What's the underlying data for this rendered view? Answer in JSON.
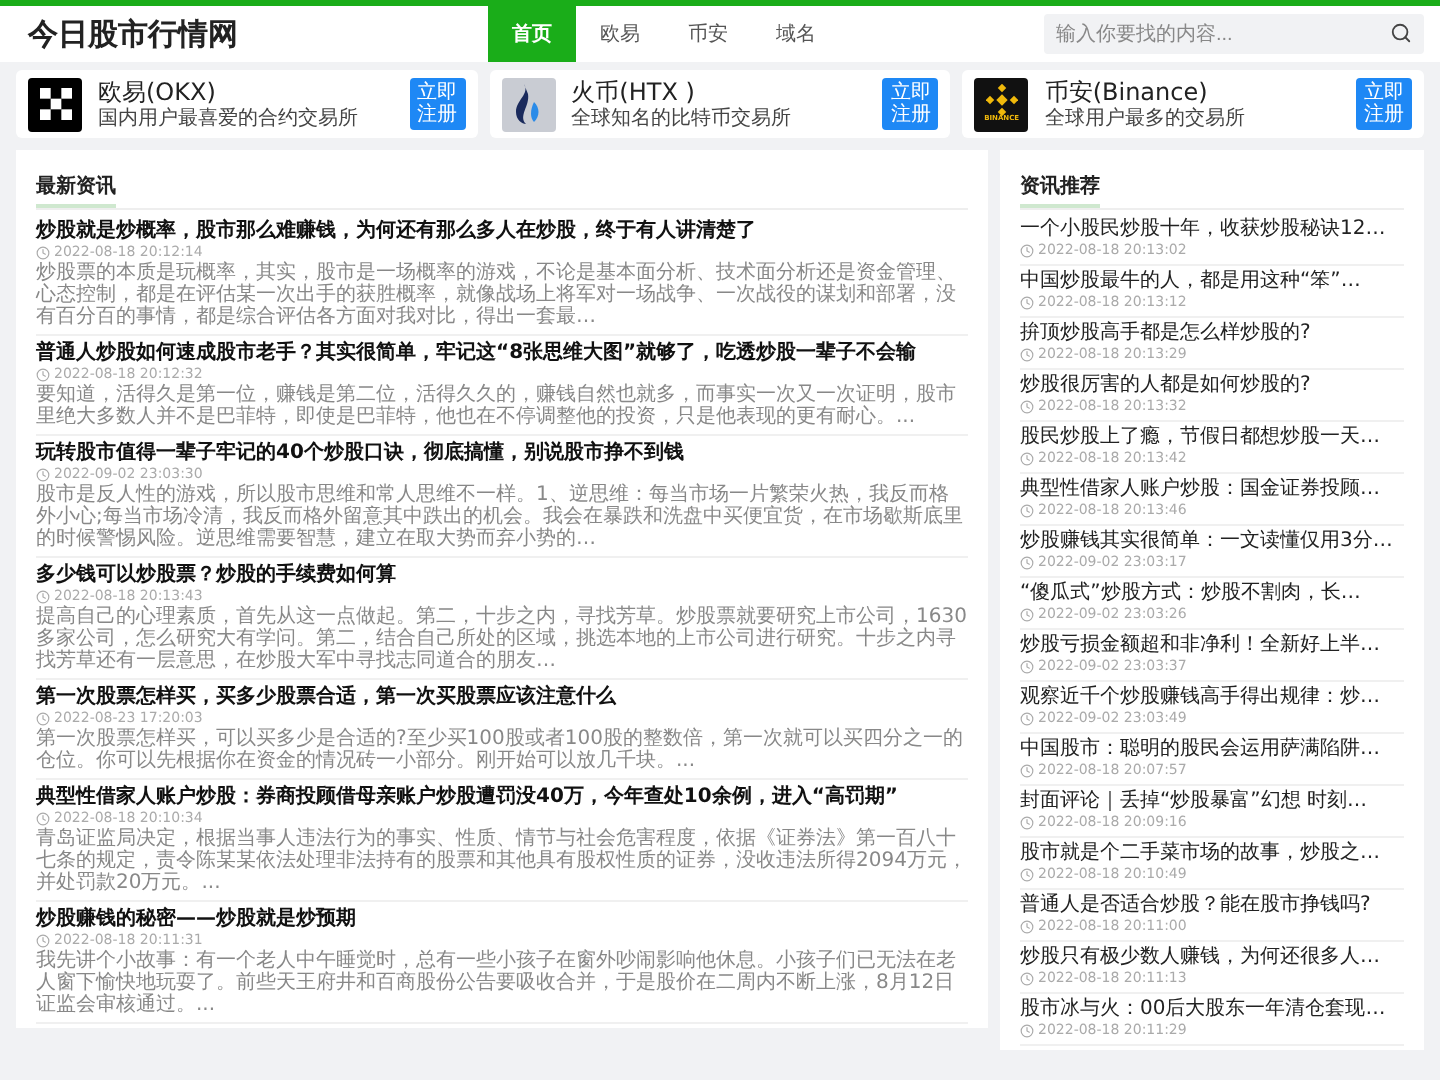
{
  "header": {
    "logo": "今日股市行情网",
    "nav": [
      {
        "label": "首页",
        "selected": true
      },
      {
        "label": "欧易",
        "selected": false
      },
      {
        "label": "币安",
        "selected": false
      },
      {
        "label": "域名",
        "selected": false
      }
    ],
    "search": {
      "placeholder": "输入你要找的内容..."
    }
  },
  "exchanges": [
    {
      "kind": "okx",
      "name": "欧易(OKX)",
      "description": "国内用户最喜爱的合约交易所",
      "button": "立即注册"
    },
    {
      "kind": "htx",
      "name": "火币(HTX )",
      "description": "全球知名的比特币交易所",
      "button": "立即注册"
    },
    {
      "kind": "binance",
      "logo_text": "BINANCE",
      "name": "币安(Binance)",
      "description": "全球用户最多的交易所",
      "button": "立即注册"
    }
  ],
  "news": {
    "title": "最新资讯",
    "items": [
      {
        "title": "炒股就是炒概率，股市那么难赚钱，为何还有那么多人在炒股，终于有人讲清楚了",
        "date": "2022-08-18 20:12:14",
        "summary": "炒股票的本质是玩概率，其实，股市是一场概率的游戏，不论是基本面分析、技术面分析还是资金管理、心态控制，都是在评估某一次出手的获胜概率，就像战场上将军对一场战争、一次战役的谋划和部署，没有百分百的事情，都是综合评估各方面对我对比，得出一套最…"
      },
      {
        "title": "普通人炒股如何速成股市老手？其实很简单，牢记这“8张思维大图”就够了，吃透炒股一辈子不会输",
        "date": "2022-08-18 20:12:32",
        "summary": "要知道，活得久是第一位，赚钱是第二位，活得久久的，赚钱自然也就多，而事实一次又一次证明，股市里绝大多数人并不是巴菲特，即使是巴菲特，他也在不停调整他的投资，只是他表现的更有耐心。..."
      },
      {
        "title": "玩转股市值得一辈子牢记的40个炒股口诀，彻底搞懂，别说股市挣不到钱",
        "date": "2022-09-02 23:03:30",
        "summary": "股市是反人性的游戏，所以股市思维和常人思维不一样。1、逆思维：每当市场一片繁荣火热，我反而格外小心;每当市场冷清，我反而格外留意其中跌出的机会。我会在暴跌和洗盘中买便宜货，在市场歇斯底里的时候警惕风险。逆思维需要智慧，建立在取大势而弃小势的…"
      },
      {
        "title": "多少钱可以炒股票？炒股的手续费如何算",
        "date": "2022-08-18 20:13:43",
        "summary": "提高自己的心理素质，首先从这一点做起。第二，十步之内，寻找芳草。炒股票就要研究上市公司，1630多家公司，怎么研究大有学问。第二，结合自己所处的区域，挑选本地的上市公司进行研究。十步之内寻找芳草还有一层意思，在炒股大军中寻找志同道合的朋友…"
      },
      {
        "title": "第一次股票怎样买，买多少股票合适，第一次买股票应该注意什么",
        "date": "2022-08-23 17:20:03",
        "summary": "第一次股票怎样买，可以买多少是合适的?至少买100股或者100股的整数倍，第一次就可以买四分之一的仓位。你可以先根据你在资金的情况砖一小部分。刚开始可以放几千块。..."
      },
      {
        "title": "典型性借家人账户炒股：券商投顾借母亲账户炒股遭罚没40万，今年查处10余例，进入“高罚期”",
        "date": "2022-08-18 20:10:34",
        "summary": "青岛证监局决定，根据当事人违法行为的事实、性质、情节与社会危害程度，依据《证券法》第一百八十七条的规定，责令陈某某依法处理非法持有的股票和其他具有股权性质的证券，没收违法所得2094万元，并处罚款20万元。..."
      },
      {
        "title": "炒股赚钱的秘密——炒股就是炒预期",
        "date": "2022-08-18 20:11:31",
        "summary": "我先讲个小故事：有一个老人中午睡觉时，总有一些小孩子在窗外吵闹影响他休息。小孩子们已无法在老人窗下愉快地玩耍了。前些天王府井和百商股份公告要吸收合并，于是股价在二周内不断上涨，8月12日证监会审核通过。..."
      }
    ]
  },
  "recommended": {
    "title": "资讯推荐",
    "items": [
      {
        "title": "一个小股民炒股十年，收获炒股秘诀12…",
        "date": "2022-08-18 20:13:02"
      },
      {
        "title": "中国炒股最牛的人，都是用这种“笨”…",
        "date": "2022-08-18 20:13:12"
      },
      {
        "title": "拚顶炒股高手都是怎么样炒股的?",
        "date": "2022-08-18 20:13:29"
      },
      {
        "title": "炒股很厉害的人都是如何炒股的?",
        "date": "2022-08-18 20:13:32"
      },
      {
        "title": "股民炒股上了瘾，节假日都想炒股一天…",
        "date": "2022-08-18 20:13:42"
      },
      {
        "title": "典型性借家人账户炒股：国金证券投顾…",
        "date": "2022-08-18 20:13:46"
      },
      {
        "title": "炒股赚钱其实很简单：一文读懂仅用3分…",
        "date": "2022-09-02 23:03:17"
      },
      {
        "title": "“傻瓜式”炒股方式：炒股不割肉，长…",
        "date": "2022-09-02 23:03:26"
      },
      {
        "title": "炒股亏损金额超和非净利！全新好上半…",
        "date": "2022-09-02 23:03:37"
      },
      {
        "title": "观察近千个炒股赚钱高手得出规律：炒…",
        "date": "2022-09-02 23:03:49"
      },
      {
        "title": "中国股市：聪明的股民会运用萨满陷阱…",
        "date": "2022-08-18 20:07:57"
      },
      {
        "title": "封面评论｜丢掉“炒股暴富”幻想 时刻…",
        "date": "2022-08-18 20:09:16"
      },
      {
        "title": "股市就是个二手菜市场的故事，炒股之…",
        "date": "2022-08-18 20:10:49"
      },
      {
        "title": "普通人是否适合炒股？能在股市挣钱吗?",
        "date": "2022-08-18 20:11:00"
      },
      {
        "title": "炒股只有极少数人赚钱，为何还很多人…",
        "date": "2022-08-18 20:11:13"
      },
      {
        "title": "股市冰与火：00后大股东一年清仓套现…",
        "date": "2022-08-18 20:11:29"
      }
    ]
  }
}
